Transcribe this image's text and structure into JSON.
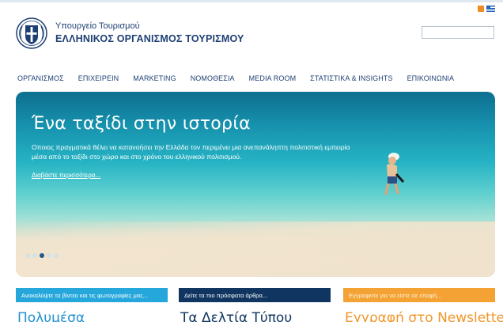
{
  "header": {
    "ministry": "Υπουργείο Τουρισμού",
    "organization": "ΕΛΛΗΝΙΚΟΣ ΟΡΓΑΝΙΣΜΟΣ ΤΟΥΡΙΣΜΟΥ",
    "search_value": ""
  },
  "icons": [
    "rss-icon",
    "greek-flag-icon",
    "coat-of-arms-icon"
  ],
  "nav": {
    "items": [
      {
        "label": "ΟΡΓΑΝΙΣΜΟΣ"
      },
      {
        "label": "ΕΠΙΧΕΙΡΕΙΝ"
      },
      {
        "label": "MARKETING"
      },
      {
        "label": "ΝΟΜΟΘΕΣΙΑ"
      },
      {
        "label": "MEDIA ROOM"
      },
      {
        "label": "ΣΤΑΤΙΣΤΙΚΑ & INSIGHTS"
      },
      {
        "label": "ΕΠΙΚΟΙΝΩΝΙΑ"
      }
    ]
  },
  "hero": {
    "title": "Ένα ταξίδι στην ιστορία",
    "text": "Οποιος πραγματικά θέλει να κατανοήσει την Ελλάδα τον περιμένει μια ανεπανάληπτη πολιτιστική εμπειρία μέσα από το ταξίδι στο χώρο και στο χρόνο του ελληνικού πολιτισμού.",
    "link": "Διαβάστε περισσότερα...",
    "slides_total": 5,
    "active_slide": 3
  },
  "boxes": [
    {
      "bar": "Ανακαλύψτε τα βίντεο και τις φωτογραφίες μας...",
      "heading": "Πολυμέσα"
    },
    {
      "bar": "Δείτε τα πιο πρόσφατα άρθρα...",
      "heading": "Τα Δελτία Τύπου"
    },
    {
      "bar": "Εγγραφείτε για να είστε σε επαφή...",
      "heading": "Εγγραφή στο Newsletter"
    }
  ],
  "colors": {
    "brand_navy": "#1e3f73",
    "box_blue": "#25a7dc",
    "box_navy": "#0f3560",
    "box_orange": "#f3a233"
  }
}
